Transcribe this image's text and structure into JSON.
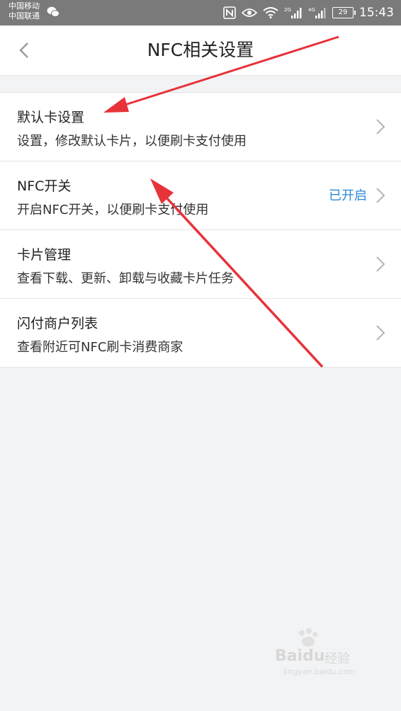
{
  "status_bar": {
    "carrier1": "中国移动",
    "carrier2": "中国联通",
    "net1": "2G",
    "net2": "4G",
    "battery": "29",
    "time": "15:43"
  },
  "header": {
    "title": "NFC相关设置"
  },
  "items": [
    {
      "title": "默认卡设置",
      "subtitle": "设置，修改默认卡片，以便刷卡支付使用",
      "status": ""
    },
    {
      "title": "NFC开关",
      "subtitle": "开启NFC开关，以便刷卡支付使用",
      "status": "已开启"
    },
    {
      "title": "卡片管理",
      "subtitle": "查看下载、更新、卸载与收藏卡片任务",
      "status": ""
    },
    {
      "title": "闪付商户列表",
      "subtitle": "查看附近可NFC刷卡消费商家",
      "status": ""
    }
  ],
  "watermark": {
    "brand": "Baidu",
    "label": "经验",
    "url": "jingyan.baidu.com"
  },
  "colors": {
    "accent": "#2b8ad8",
    "annotation": "#e8323a",
    "statusbar": "#7a7a7a"
  }
}
